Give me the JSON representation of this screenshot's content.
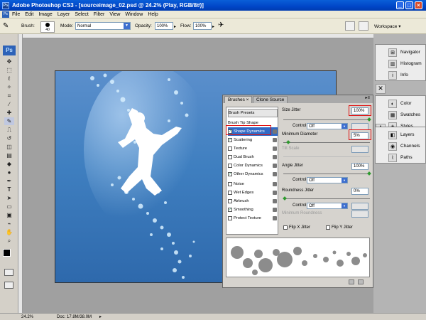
{
  "window": {
    "title": "Adobe Photoshop CS3 - [sourceimage_02.psd @ 24.2% (Play, RGB/8#)]"
  },
  "menu": {
    "items": [
      "File",
      "Edit",
      "Image",
      "Layer",
      "Select",
      "Filter",
      "View",
      "Window",
      "Help"
    ],
    "logo": "Ps"
  },
  "options": {
    "brush_label": "Brush:",
    "brush_size": "40",
    "mode_label": "Mode:",
    "mode_value": "Normal",
    "opacity_label": "Opacity:",
    "opacity_value": "100%",
    "flow_label": "Flow:",
    "flow_value": "100%",
    "workspace_label": "Workspace"
  },
  "toolbox": {
    "logo": "Ps"
  },
  "dock": {
    "group1": [
      "Navigator",
      "Histogram",
      "Info"
    ],
    "group2": [
      "Color",
      "Swatches",
      "Styles"
    ],
    "group3": [
      "Layers",
      "Channels",
      "Paths"
    ]
  },
  "brushes_panel": {
    "tabs": [
      "Brushes",
      "Clone Source"
    ],
    "left_items": [
      {
        "label": "Brush Presets",
        "type": "header",
        "checked": false
      },
      {
        "label": "Brush Tip Shape",
        "type": "plain",
        "checked": false
      },
      {
        "label": "Shape Dynamics",
        "type": "check",
        "checked": true,
        "selected": true
      },
      {
        "label": "Scattering",
        "type": "check",
        "checked": true
      },
      {
        "label": "Texture",
        "type": "check",
        "checked": false
      },
      {
        "label": "Dual Brush",
        "type": "check",
        "checked": false
      },
      {
        "label": "Color Dynamics",
        "type": "check",
        "checked": false
      },
      {
        "label": "Other Dynamics",
        "type": "check",
        "checked": true
      },
      {
        "label": "Noise",
        "type": "check",
        "checked": false
      },
      {
        "label": "Wet Edges",
        "type": "check",
        "checked": false
      },
      {
        "label": "Airbrush",
        "type": "check",
        "checked": false
      },
      {
        "label": "Smoothing",
        "type": "check",
        "checked": true
      },
      {
        "label": "Protect Texture",
        "type": "check",
        "checked": false
      }
    ],
    "size_jitter_label": "Size Jitter",
    "size_jitter_value": "100%",
    "control_label": "Control:",
    "control_off": "Off",
    "min_diameter_label": "Minimum Diameter",
    "min_diameter_value": "5%",
    "tilt_scale_label": "Tilt Scale",
    "angle_jitter_label": "Angle Jitter",
    "angle_jitter_value": "100%",
    "roundness_jitter_label": "Roundness Jitter",
    "roundness_jitter_value": "0%",
    "min_roundness_label": "Minimum Roundness",
    "flip_x_label": "Flip X Jitter",
    "flip_y_label": "Flip Y Jitter"
  },
  "status": {
    "zoom": "24.2%",
    "doc": "Doc: 17.8M/38.0M"
  },
  "colors": {
    "title_blue": "#0046c8",
    "highlight_red": "#e01010",
    "canvas_blue": "#3f7fc0"
  }
}
